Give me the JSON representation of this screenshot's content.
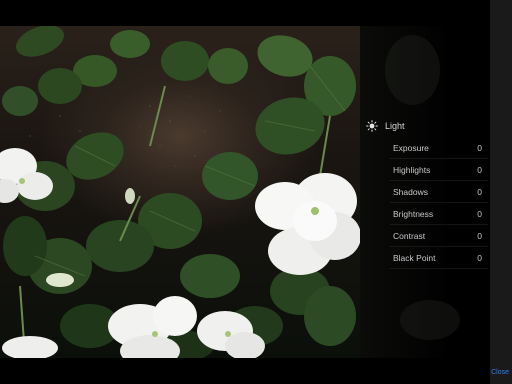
{
  "adjustments": {
    "section": {
      "label": "Light",
      "icon": "sun-icon"
    },
    "rows": [
      {
        "label": "Exposure",
        "value": "0"
      },
      {
        "label": "Highlights",
        "value": "0"
      },
      {
        "label": "Shadows",
        "value": "0"
      },
      {
        "label": "Brightness",
        "value": "0"
      },
      {
        "label": "Contrast",
        "value": "0"
      },
      {
        "label": "Black Point",
        "value": "0"
      }
    ]
  },
  "toolbar": {
    "close_label": "Close"
  },
  "colors": {
    "accent": "#2f7ff0",
    "background": "#000000",
    "panel_text": "#c9c9c9"
  }
}
